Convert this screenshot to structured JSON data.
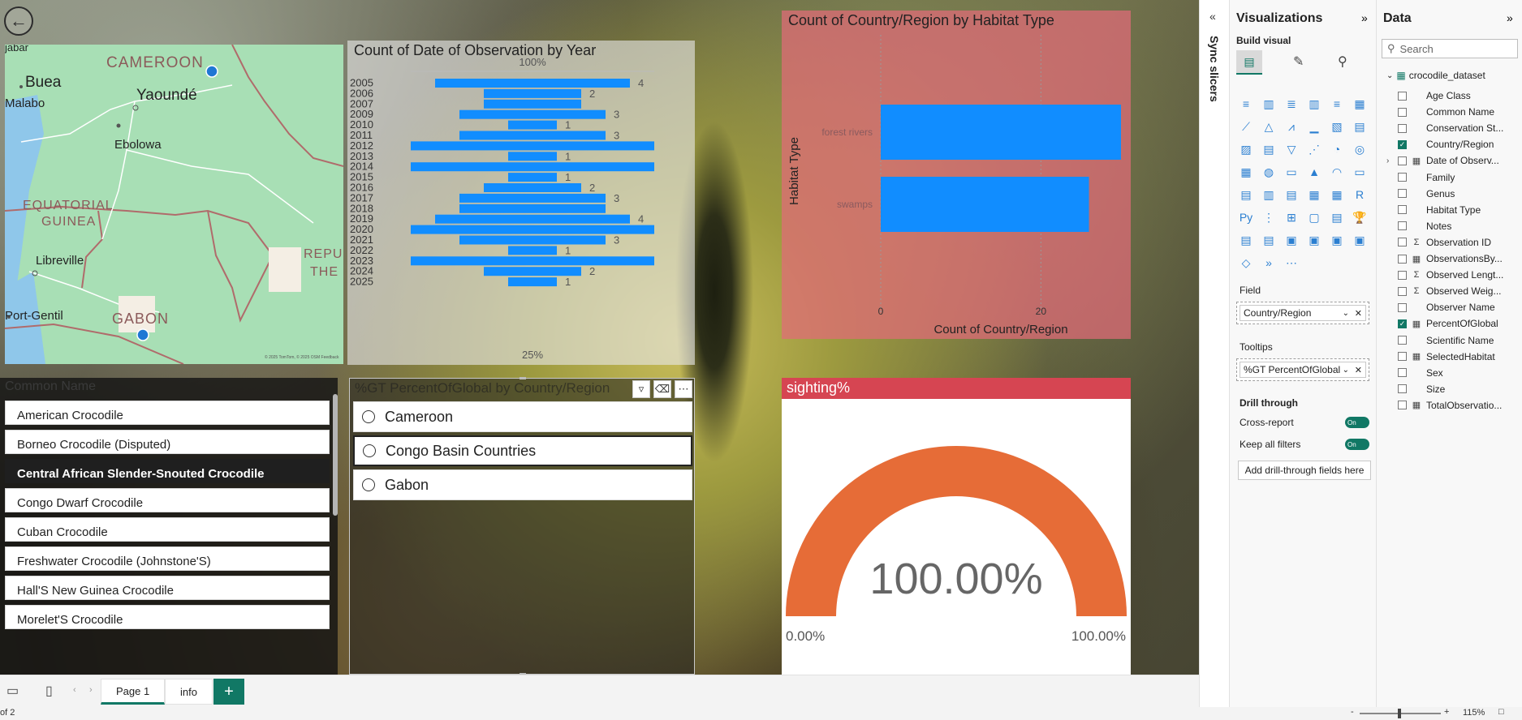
{
  "map": {
    "labels": {
      "cameroon": "CAMEROON",
      "yaounde": "Yaoundé",
      "buea": "Buea",
      "malabo": "Malabo",
      "ebolowa": "Ebolowa",
      "eq_guinea_1": "EQUATORIAL",
      "eq_guinea_2": "GUINEA",
      "libreville": "Libreville",
      "port_gentil": "Port-Gentil",
      "gabon": "GABON",
      "repu": "REPU",
      "the": "THE",
      "jabar": "jabar",
      "attribution": "© 2025 TomTom, © 2025 OSM  Feedback"
    },
    "colors": {
      "land": "#a8dfb5",
      "water": "#8fc7ea",
      "border": "#b06b6b",
      "road": "#ffffff",
      "point": "#1f77d4"
    }
  },
  "date_chart": {
    "title": "Count of Date of Observation by Year",
    "top_axis_label": "100%",
    "bottom_axis_label": "25%",
    "bar_color": "#118DFF"
  },
  "habitat_chart": {
    "title": "Count of Country/Region by Habitat Type",
    "ylabel": "Habitat Type",
    "xlabel": "Count of Country/Region",
    "bar_color": "#118DFF"
  },
  "chart_data": [
    {
      "type": "bar",
      "title": "Count of Date of Observation by Year",
      "categories": [
        "2005",
        "2006",
        "2007",
        "2009",
        "2010",
        "2011",
        "2012",
        "2013",
        "2014",
        "2015",
        "2016",
        "2017",
        "2018",
        "2019",
        "2020",
        "2021",
        "2022",
        "2023",
        "2024",
        "2025"
      ],
      "values": [
        4,
        2,
        2,
        3,
        1,
        3,
        5,
        1,
        5,
        1,
        2,
        3,
        3,
        4,
        5,
        3,
        1,
        5,
        2,
        1
      ],
      "data_labels": [
        "4",
        "2",
        "",
        "3",
        "1",
        "3",
        "",
        "1",
        "",
        "1",
        "2",
        "3",
        "",
        "4",
        "",
        "3",
        "1",
        "",
        "2",
        "1"
      ],
      "orientation": "horizontal-funnel"
    },
    {
      "type": "bar",
      "title": "Count of Country/Region by Habitat Type",
      "categories": [
        "forest rivers",
        "swamps"
      ],
      "values": [
        30,
        26
      ],
      "xlabel": "Count of Country/Region",
      "ylabel": "Habitat Type",
      "x_ticks": [
        "0",
        "20"
      ],
      "xlim": [
        0,
        30
      ]
    },
    {
      "type": "gauge",
      "title": "sighting%",
      "value": 100.0,
      "value_label": "100.00%",
      "min_label": "0.00%",
      "max_label": "100.00%",
      "color": "#E66C37"
    }
  ],
  "names_slicer": {
    "header": "Common Name",
    "items": [
      "American Crocodile",
      "Borneo Crocodile (Disputed)",
      "Central African Slender-Snouted Crocodile",
      "Congo Dwarf Crocodile",
      "Cuban Crocodile",
      "Freshwater Crocodile (Johnstone'S)",
      "Hall'S New Guinea Crocodile",
      "Morelet'S Crocodile"
    ],
    "selected": "Central African Slender-Snouted Crocodile"
  },
  "region_slicer": {
    "header": "%GT PercentOfGlobal by Country/Region",
    "items": [
      "Cameroon",
      "Congo Basin Countries",
      "Gabon"
    ],
    "focused": "Congo Basin Countries"
  },
  "gauge": {
    "title": "sighting%",
    "value_label": "100.00%",
    "min_label": "0.00%",
    "max_label": "100.00%"
  },
  "pagebar": {
    "tabs": [
      "Page 1",
      "info"
    ],
    "active": "Page 1",
    "add": "+"
  },
  "statusbar": {
    "page_info": "of 2",
    "zoom": "115%",
    "minus": "-",
    "plus": "+"
  },
  "sync_pane": {
    "label": "Sync slicers"
  },
  "viz_pane": {
    "title": "Visualizations",
    "build_visual": "Build visual",
    "field_label": "Field",
    "field_value": "Country/Region",
    "tooltips_label": "Tooltips",
    "tooltips_value": "%GT PercentOfGlobal",
    "drill_label": "Drill through",
    "cross_report": "Cross-report",
    "keep_filters": "Keep all filters",
    "toggle_on": "On",
    "add_drill": "Add drill-through fields here"
  },
  "data_pane": {
    "title": "Data",
    "search_placeholder": "Search",
    "dataset": "crocodile_dataset",
    "fields": [
      {
        "name": "Age Class",
        "checked": false,
        "icon": ""
      },
      {
        "name": "Common Name",
        "checked": false,
        "icon": ""
      },
      {
        "name": "Conservation St...",
        "checked": false,
        "icon": ""
      },
      {
        "name": "Country/Region",
        "checked": true,
        "icon": ""
      },
      {
        "name": "Date of Observ...",
        "checked": false,
        "icon": "table-icon",
        "expandable": true
      },
      {
        "name": "Family",
        "checked": false,
        "icon": ""
      },
      {
        "name": "Genus",
        "checked": false,
        "icon": ""
      },
      {
        "name": "Habitat Type",
        "checked": false,
        "icon": ""
      },
      {
        "name": "Notes",
        "checked": false,
        "icon": ""
      },
      {
        "name": "Observation ID",
        "checked": false,
        "icon": "sigma-icon"
      },
      {
        "name": "ObservationsBy...",
        "checked": false,
        "icon": "calc-icon"
      },
      {
        "name": "Observed Lengt...",
        "checked": false,
        "icon": "sigma-icon"
      },
      {
        "name": "Observed Weig...",
        "checked": false,
        "icon": "sigma-icon"
      },
      {
        "name": "Observer Name",
        "checked": false,
        "icon": ""
      },
      {
        "name": "PercentOfGlobal",
        "checked": true,
        "icon": "calc-icon"
      },
      {
        "name": "Scientific Name",
        "checked": false,
        "icon": ""
      },
      {
        "name": "SelectedHabitat",
        "checked": false,
        "icon": "calc-icon"
      },
      {
        "name": "Sex",
        "checked": false,
        "icon": ""
      },
      {
        "name": "Size",
        "checked": false,
        "icon": ""
      },
      {
        "name": "TotalObservatio...",
        "checked": false,
        "icon": "calc-icon"
      }
    ]
  }
}
